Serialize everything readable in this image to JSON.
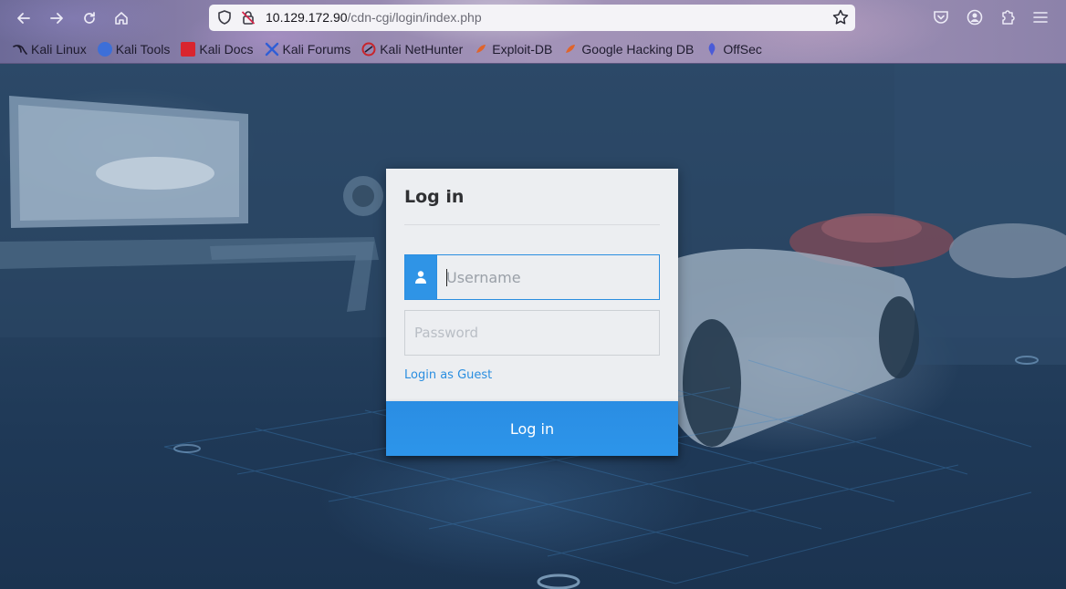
{
  "browser": {
    "url_host": "10.129.172.90",
    "url_path": "/cdn-cgi/login/index.php",
    "bookmarks": [
      {
        "label": "Kali Linux",
        "icon": "kali-dragon-icon",
        "color": "#2b2b2b"
      },
      {
        "label": "Kali Tools",
        "icon": "kali-tools-icon",
        "color": "#3d6fd8"
      },
      {
        "label": "Kali Docs",
        "icon": "kali-docs-icon",
        "color": "#d9252f"
      },
      {
        "label": "Kali Forums",
        "icon": "kali-forums-icon",
        "color": "#2f5ed6"
      },
      {
        "label": "Kali NetHunter",
        "icon": "nethunter-icon",
        "color": "#c8252b"
      },
      {
        "label": "Exploit-DB",
        "icon": "exploit-db-icon",
        "color": "#e0642a"
      },
      {
        "label": "Google Hacking DB",
        "icon": "ghdb-icon",
        "color": "#e0642a"
      },
      {
        "label": "OffSec",
        "icon": "offsec-icon",
        "color": "#4a5bd8"
      }
    ]
  },
  "login": {
    "title": "Log in",
    "username_placeholder": "Username",
    "password_placeholder": "Password",
    "guest_link": "Login as Guest",
    "submit_label": "Log in",
    "accent_color": "#2f94e6"
  }
}
